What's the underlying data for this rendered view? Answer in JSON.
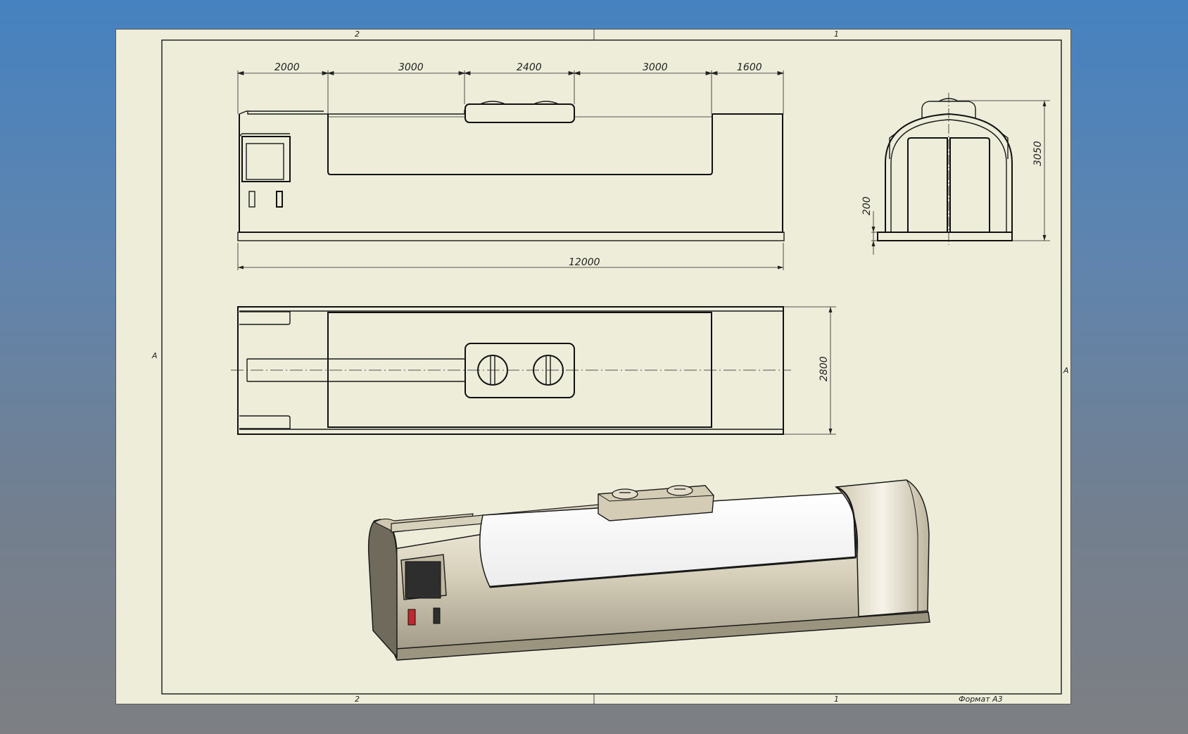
{
  "sheet": {
    "zones_top": [
      "2",
      "1"
    ],
    "zones_bottom": [
      "2",
      "1"
    ],
    "zone_left": "A",
    "zone_right": "A",
    "format_label": "Формат А3"
  },
  "dimensions": {
    "front_segments": [
      "2000",
      "3000",
      "2400",
      "3000",
      "1600"
    ],
    "front_total": "12000",
    "side_height": "3050",
    "side_base": "200",
    "top_width": "2800"
  },
  "colors": {
    "background_top": "#4682c0",
    "background_bottom": "#7d7f83",
    "sheet": "#ededda",
    "body_shade": "#cfc7b0",
    "screen": "#2e2e2e",
    "indicator": "#c0282c"
  }
}
